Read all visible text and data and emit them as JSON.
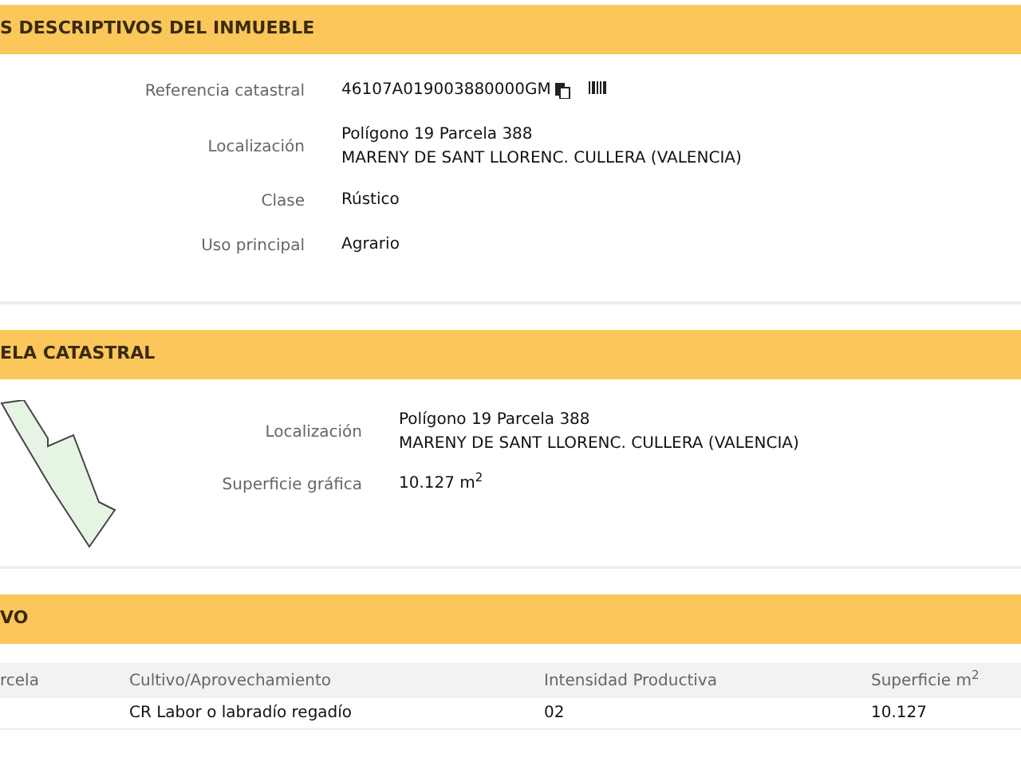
{
  "sections": [
    {
      "title": "S DESCRIPTIVOS DEL INMUEBLE",
      "kind": "fields",
      "fields": [
        {
          "label": "Referencia catastral",
          "lines": [
            "46107A019003880000GM"
          ],
          "icons": true
        },
        {
          "label": "Localización",
          "lines": [
            "Polígono 19 Parcela 388",
            "MARENY DE SANT LLORENC. CULLERA (VALENCIA)"
          ]
        },
        {
          "label": "Clase",
          "lines": [
            "Rústico"
          ]
        },
        {
          "label": "Uso principal",
          "lines": [
            "Agrario"
          ]
        }
      ]
    },
    {
      "title": "ELA CATASTRAL",
      "kind": "parcel",
      "fields": [
        {
          "label": "Localización",
          "lines": [
            "Polígono 19 Parcela 388",
            "MARENY DE SANT LLORENC. CULLERA (VALENCIA)"
          ]
        },
        {
          "label": "Superficie gráfica",
          "lines": [
            "10.127 m$^{2}$"
          ]
        }
      ]
    },
    {
      "title": "VO",
      "kind": "table",
      "columns": [
        "rcela",
        "Cultivo/Aprovechamiento",
        "Intensidad Productiva",
        "Superficie m$^{2}$"
      ],
      "rows": [
        [
          "",
          "CR Labor o labradío regadío",
          "02",
          "10.127"
        ]
      ]
    }
  ]
}
